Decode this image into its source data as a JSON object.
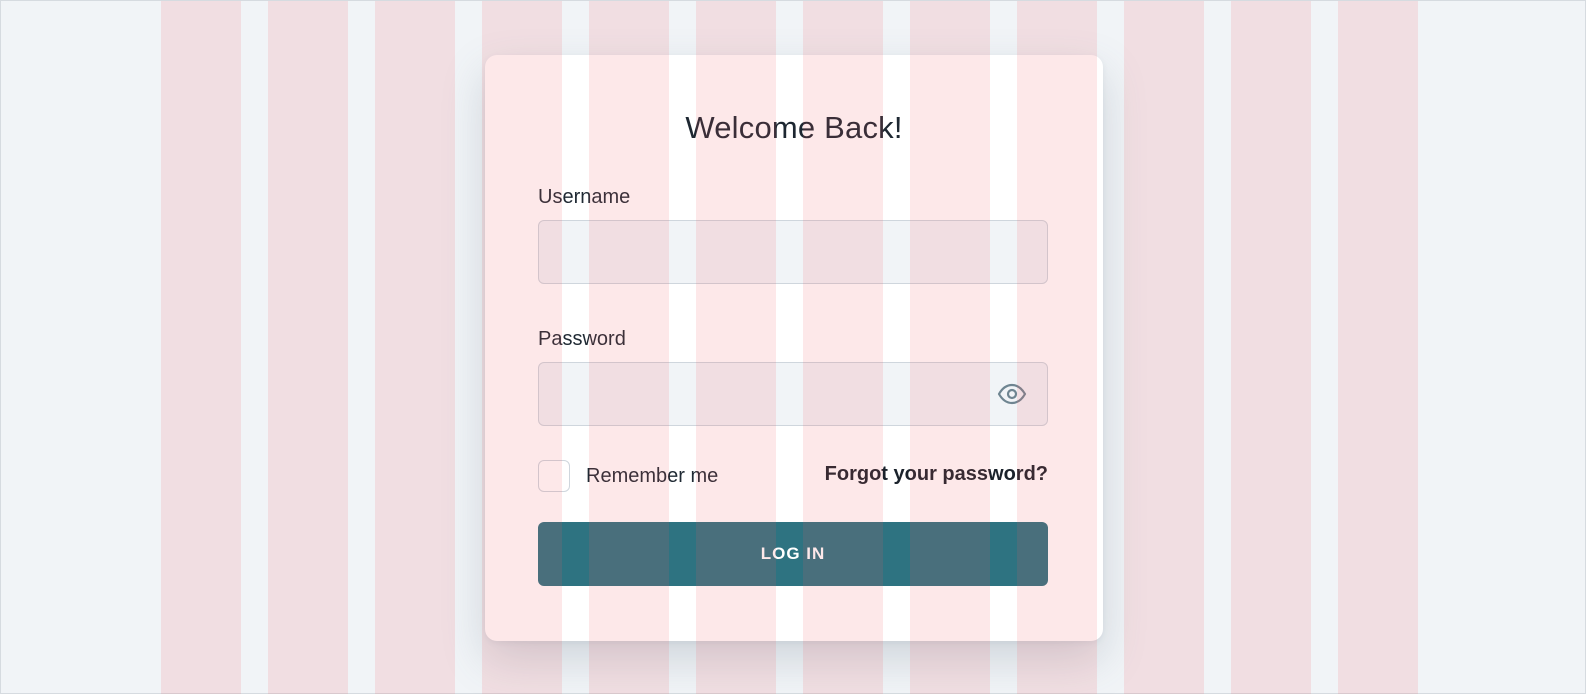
{
  "login_card": {
    "title": "Welcome Back!",
    "username": {
      "label": "Username",
      "value": "",
      "placeholder": ""
    },
    "password": {
      "label": "Password",
      "value": "",
      "placeholder": "",
      "toggle_icon": "eye-icon"
    },
    "remember_me": {
      "label": "Remember me",
      "checked": false
    },
    "forgot_password_label": "Forgot your password?",
    "login_button_label": "LOG IN"
  },
  "colors": {
    "page_background": "#f1f4f7",
    "card_background": "#ffffff",
    "input_background": "#f1f4f7",
    "button_primary": "#2e7381",
    "grid_overlay": "rgba(240, 90, 100, 0.14)",
    "text_primary": "#1f2933"
  }
}
